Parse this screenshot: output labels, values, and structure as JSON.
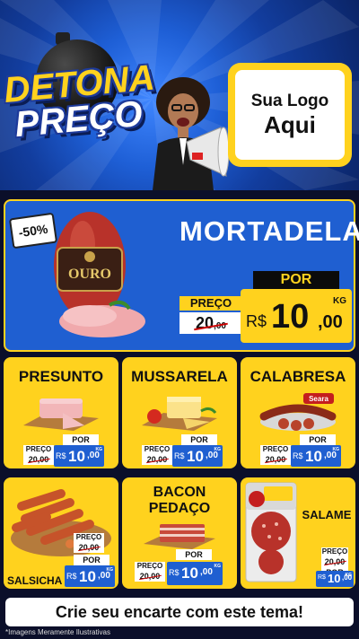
{
  "header": {
    "title_line1": "DETONA",
    "title_line2": "PREÇO",
    "logo_line1": "Sua Logo",
    "logo_line2": "Aqui"
  },
  "featured": {
    "discount": "-50%",
    "brand": "OURO",
    "name": "MORTADELA",
    "por_label": "POR",
    "preco_label": "PREÇO",
    "old_int": "20",
    "old_cents": ",00",
    "currency": "R$",
    "price_int": "10",
    "price_cents": ",00",
    "unit": "KG"
  },
  "products": [
    {
      "name": "PRESUNTO",
      "por": "POR",
      "preco": "PREÇO",
      "old": "20,00",
      "currency": "R$",
      "int": "10",
      "cents": ",00",
      "unit": "KG"
    },
    {
      "name": "MUSSARELA",
      "por": "POR",
      "preco": "PREÇO",
      "old": "20,00",
      "currency": "R$",
      "int": "10",
      "cents": ",00",
      "unit": "KG"
    },
    {
      "name": "CALABRESA",
      "por": "POR",
      "preco": "PREÇO",
      "old": "20,00",
      "currency": "R$",
      "int": "10",
      "cents": ",00",
      "unit": "KG",
      "brand": "Seara"
    },
    {
      "name": "SALSICHA",
      "por": "POR",
      "preco": "PREÇO",
      "old": "20,00",
      "currency": "R$",
      "int": "10",
      "cents": ",00",
      "unit": "KG"
    },
    {
      "name_line1": "BACON",
      "name_line2": "PEDAÇO",
      "por": "POR",
      "preco": "PREÇO",
      "old": "20,00",
      "currency": "R$",
      "int": "10",
      "cents": ",00",
      "unit": "KG"
    },
    {
      "name": "SALAME",
      "por": "POR",
      "preco": "PREÇO",
      "old": "20,00",
      "currency": "R$",
      "int": "10",
      "cents": ",00",
      "unit": "KG"
    }
  ],
  "footer": {
    "cta": "Crie seu encarte com este tema!",
    "note": "*Imagens Meramente Ilustrativas"
  },
  "colors": {
    "accent_yellow": "#ffd21e",
    "accent_blue": "#1f5fd1",
    "background": "#0b0f2a"
  }
}
